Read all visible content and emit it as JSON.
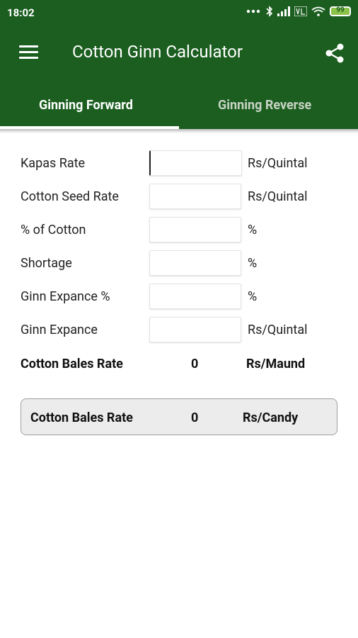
{
  "status_bar": {
    "time": "18:02",
    "battery": "99"
  },
  "app_bar": {
    "title": "Cotton Ginn Calculator"
  },
  "tabs": [
    {
      "label": "Ginning Forward",
      "selected": true
    },
    {
      "label": "Ginning Reverse",
      "selected": false
    }
  ],
  "form": {
    "fields": [
      {
        "label": "Kapas Rate",
        "value": "",
        "unit": "Rs/Quintal"
      },
      {
        "label": "Cotton Seed Rate",
        "value": "",
        "unit": "Rs/Quintal"
      },
      {
        "label": "% of Cotton",
        "value": "",
        "unit": "%"
      },
      {
        "label": "Shortage",
        "value": "",
        "unit": "%"
      },
      {
        "label": "Ginn Expance %",
        "value": "",
        "unit": "%"
      },
      {
        "label": "Ginn Expance",
        "value": "",
        "unit": "Rs/Quintal"
      }
    ]
  },
  "result_maund": {
    "label": "Cotton Bales Rate",
    "value": "0",
    "unit": "Rs/Maund"
  },
  "result_candy": {
    "label": "Cotton Bales Rate",
    "value": "0",
    "unit": "Rs/Candy"
  },
  "colors": {
    "primary": "#1b5e20",
    "tab_inactive_text": "#c8d4c6",
    "result_box_bg": "#ececec"
  },
  "icons": [
    "menu-icon",
    "share-icon",
    "bluetooth-icon",
    "signal-icon",
    "wifi-icon",
    "battery-icon"
  ]
}
